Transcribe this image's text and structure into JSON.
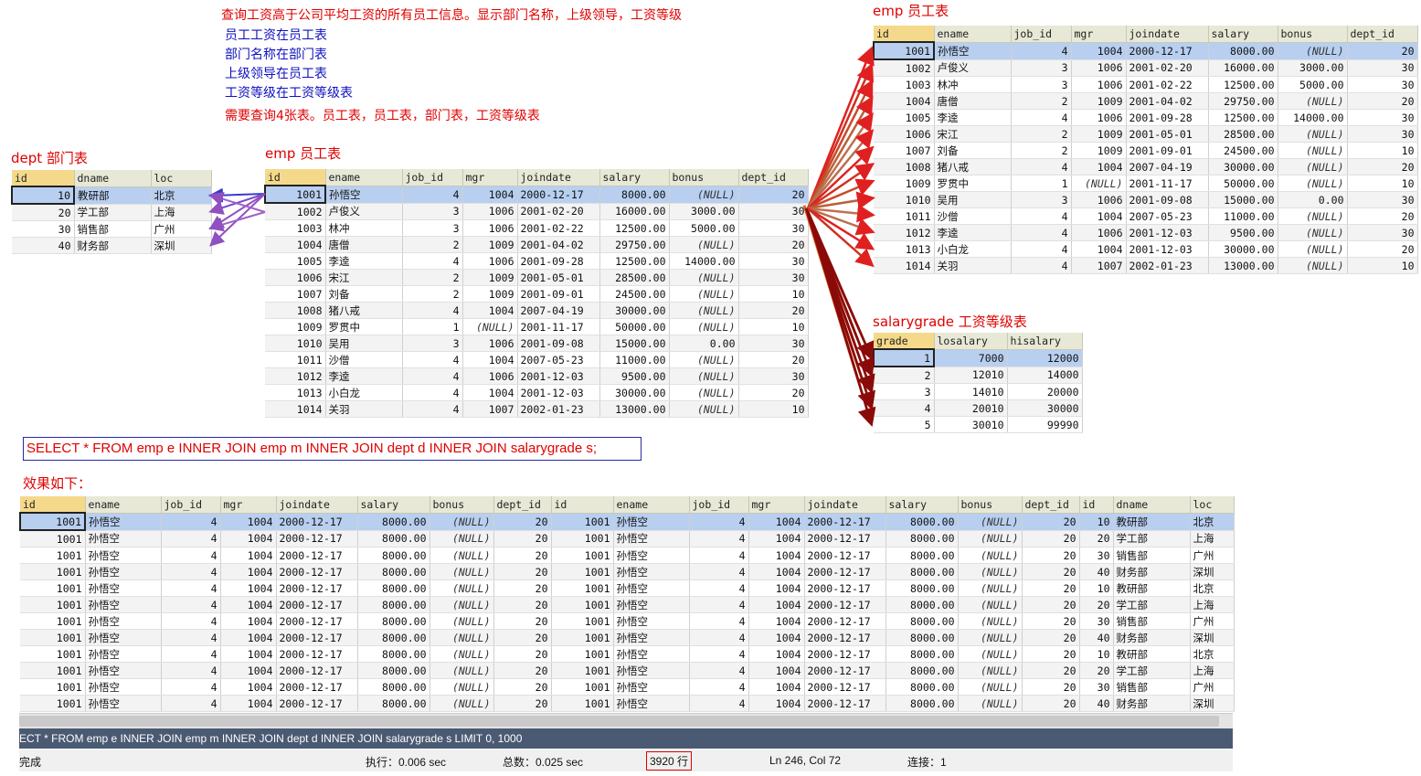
{
  "notes": {
    "title": "查询工资高于公司平均工资的所有员工信息。显示部门名称，上级领导，工资等级",
    "line1": "员工工资在员工表",
    "line2": "部门名称在部门表",
    "line3": "上级领导在员工表",
    "line4": "工资等级在工资等级表",
    "need": "需要查询4张表。员工表，员工表，部门表，工资等级表"
  },
  "labels": {
    "dept": "dept 部门表",
    "emp_left": "emp 员工表",
    "emp_right": "emp 员工表",
    "salarygrade": "salarygrade 工资等级表"
  },
  "dept": {
    "columns": [
      "id",
      "dname",
      "loc"
    ],
    "rows": [
      [
        "10",
        "教研部",
        "北京"
      ],
      [
        "20",
        "学工部",
        "上海"
      ],
      [
        "30",
        "销售部",
        "广州"
      ],
      [
        "40",
        "财务部",
        "深圳"
      ]
    ]
  },
  "emp": {
    "columns": [
      "id",
      "ename",
      "job_id",
      "mgr",
      "joindate",
      "salary",
      "bonus",
      "dept_id"
    ],
    "rows": [
      [
        "1001",
        "孙悟空",
        "4",
        "1004",
        "2000-12-17",
        "8000.00",
        "(NULL)",
        "20"
      ],
      [
        "1002",
        "卢俊义",
        "3",
        "1006",
        "2001-02-20",
        "16000.00",
        "3000.00",
        "30"
      ],
      [
        "1003",
        "林冲",
        "3",
        "1006",
        "2001-02-22",
        "12500.00",
        "5000.00",
        "30"
      ],
      [
        "1004",
        "唐僧",
        "2",
        "1009",
        "2001-04-02",
        "29750.00",
        "(NULL)",
        "20"
      ],
      [
        "1005",
        "李逵",
        "4",
        "1006",
        "2001-09-28",
        "12500.00",
        "14000.00",
        "30"
      ],
      [
        "1006",
        "宋江",
        "2",
        "1009",
        "2001-05-01",
        "28500.00",
        "(NULL)",
        "30"
      ],
      [
        "1007",
        "刘备",
        "2",
        "1009",
        "2001-09-01",
        "24500.00",
        "(NULL)",
        "10"
      ],
      [
        "1008",
        "猪八戒",
        "4",
        "1004",
        "2007-04-19",
        "30000.00",
        "(NULL)",
        "20"
      ],
      [
        "1009",
        "罗贯中",
        "1",
        "(NULL)",
        "2001-11-17",
        "50000.00",
        "(NULL)",
        "10"
      ],
      [
        "1010",
        "吴用",
        "3",
        "1006",
        "2001-09-08",
        "15000.00",
        "0.00",
        "30"
      ],
      [
        "1011",
        "沙僧",
        "4",
        "1004",
        "2007-05-23",
        "11000.00",
        "(NULL)",
        "20"
      ],
      [
        "1012",
        "李逵",
        "4",
        "1006",
        "2001-12-03",
        "9500.00",
        "(NULL)",
        "30"
      ],
      [
        "1013",
        "小白龙",
        "4",
        "1004",
        "2001-12-03",
        "30000.00",
        "(NULL)",
        "20"
      ],
      [
        "1014",
        "关羽",
        "4",
        "1007",
        "2002-01-23",
        "13000.00",
        "(NULL)",
        "10"
      ]
    ]
  },
  "emp2_rows": [
    [
      "1001",
      "孙悟空",
      "4",
      "1004",
      "2000-12-17",
      "8000.00",
      "(NULL)",
      "20"
    ],
    [
      "1002",
      "卢俊义",
      "3",
      "1006",
      "2001-02-20",
      "16000.00",
      "3000.00",
      "30"
    ],
    [
      "1003",
      "林冲",
      "3",
      "1006",
      "2001-02-22",
      "12500.00",
      "5000.00",
      "30"
    ],
    [
      "1004",
      "唐僧",
      "2",
      "1009",
      "2001-04-02",
      "29750.00",
      "(NULL)",
      "20"
    ],
    [
      "1005",
      "李逵",
      "4",
      "1006",
      "2001-09-28",
      "12500.00",
      "14000.00",
      "30"
    ],
    [
      "1006",
      "宋江",
      "2",
      "1009",
      "2001-05-01",
      "28500.00",
      "(NULL)",
      "30"
    ],
    [
      "1007",
      "刘备",
      "2",
      "1009",
      "2001-09-01",
      "24500.00",
      "(NULL)",
      "10"
    ],
    [
      "1008",
      "猪八戒",
      "4",
      "1004",
      "2007-04-19",
      "30000.00",
      "(NULL)",
      "20"
    ],
    [
      "1009",
      "罗贯中",
      "1",
      "(NULL)",
      "2001-11-17",
      "50000.00",
      "(NULL)",
      "10"
    ],
    [
      "1010",
      "吴用",
      "3",
      "1006",
      "2001-09-08",
      "15000.00",
      "0.00",
      "30"
    ],
    [
      "1011",
      "沙僧",
      "4",
      "1004",
      "2007-05-23",
      "11000.00",
      "(NULL)",
      "20"
    ],
    [
      "1012",
      "李逵",
      "4",
      "1006",
      "2001-12-03",
      "9500.00",
      "(NULL)",
      "30"
    ],
    [
      "1013",
      "小白龙",
      "4",
      "1004",
      "2001-12-03",
      "30000.00",
      "(NULL)",
      "20"
    ],
    [
      "1014",
      "关羽",
      "4",
      "1007",
      "2002-01-23",
      "13000.00",
      "(NULL)",
      "10"
    ]
  ],
  "salarygrade": {
    "columns": [
      "grade",
      "losalary",
      "hisalary"
    ],
    "rows": [
      [
        "1",
        "7000",
        "12000"
      ],
      [
        "2",
        "12010",
        "14000"
      ],
      [
        "3",
        "14010",
        "20000"
      ],
      [
        "4",
        "20010",
        "30000"
      ],
      [
        "5",
        "30010",
        "99990"
      ]
    ]
  },
  "sql": "SELECT * FROM emp e INNER JOIN emp m INNER JOIN dept d INNER JOIN salarygrade s;",
  "result_label": "效果如下：",
  "result": {
    "columns": [
      "id",
      "ename",
      "job_id",
      "mgr",
      "joindate",
      "salary",
      "bonus",
      "dept_id",
      "id",
      "ename",
      "job_id",
      "mgr",
      "joindate",
      "salary",
      "bonus",
      "dept_id",
      "id",
      "dname",
      "loc"
    ],
    "rows": [
      [
        "1001",
        "孙悟空",
        "4",
        "1004",
        "2000-12-17",
        "8000.00",
        "(NULL)",
        "20",
        "1001",
        "孙悟空",
        "4",
        "1004",
        "2000-12-17",
        "8000.00",
        "(NULL)",
        "20",
        "10",
        "教研部",
        "北京"
      ],
      [
        "1001",
        "孙悟空",
        "4",
        "1004",
        "2000-12-17",
        "8000.00",
        "(NULL)",
        "20",
        "1001",
        "孙悟空",
        "4",
        "1004",
        "2000-12-17",
        "8000.00",
        "(NULL)",
        "20",
        "20",
        "学工部",
        "上海"
      ],
      [
        "1001",
        "孙悟空",
        "4",
        "1004",
        "2000-12-17",
        "8000.00",
        "(NULL)",
        "20",
        "1001",
        "孙悟空",
        "4",
        "1004",
        "2000-12-17",
        "8000.00",
        "(NULL)",
        "20",
        "30",
        "销售部",
        "广州"
      ],
      [
        "1001",
        "孙悟空",
        "4",
        "1004",
        "2000-12-17",
        "8000.00",
        "(NULL)",
        "20",
        "1001",
        "孙悟空",
        "4",
        "1004",
        "2000-12-17",
        "8000.00",
        "(NULL)",
        "20",
        "40",
        "财务部",
        "深圳"
      ],
      [
        "1001",
        "孙悟空",
        "4",
        "1004",
        "2000-12-17",
        "8000.00",
        "(NULL)",
        "20",
        "1001",
        "孙悟空",
        "4",
        "1004",
        "2000-12-17",
        "8000.00",
        "(NULL)",
        "20",
        "10",
        "教研部",
        "北京"
      ],
      [
        "1001",
        "孙悟空",
        "4",
        "1004",
        "2000-12-17",
        "8000.00",
        "(NULL)",
        "20",
        "1001",
        "孙悟空",
        "4",
        "1004",
        "2000-12-17",
        "8000.00",
        "(NULL)",
        "20",
        "20",
        "学工部",
        "上海"
      ],
      [
        "1001",
        "孙悟空",
        "4",
        "1004",
        "2000-12-17",
        "8000.00",
        "(NULL)",
        "20",
        "1001",
        "孙悟空",
        "4",
        "1004",
        "2000-12-17",
        "8000.00",
        "(NULL)",
        "20",
        "30",
        "销售部",
        "广州"
      ],
      [
        "1001",
        "孙悟空",
        "4",
        "1004",
        "2000-12-17",
        "8000.00",
        "(NULL)",
        "20",
        "1001",
        "孙悟空",
        "4",
        "1004",
        "2000-12-17",
        "8000.00",
        "(NULL)",
        "20",
        "40",
        "财务部",
        "深圳"
      ],
      [
        "1001",
        "孙悟空",
        "4",
        "1004",
        "2000-12-17",
        "8000.00",
        "(NULL)",
        "20",
        "1001",
        "孙悟空",
        "4",
        "1004",
        "2000-12-17",
        "8000.00",
        "(NULL)",
        "20",
        "10",
        "教研部",
        "北京"
      ],
      [
        "1001",
        "孙悟空",
        "4",
        "1004",
        "2000-12-17",
        "8000.00",
        "(NULL)",
        "20",
        "1001",
        "孙悟空",
        "4",
        "1004",
        "2000-12-17",
        "8000.00",
        "(NULL)",
        "20",
        "20",
        "学工部",
        "上海"
      ],
      [
        "1001",
        "孙悟空",
        "4",
        "1004",
        "2000-12-17",
        "8000.00",
        "(NULL)",
        "20",
        "1001",
        "孙悟空",
        "4",
        "1004",
        "2000-12-17",
        "8000.00",
        "(NULL)",
        "20",
        "30",
        "销售部",
        "广州"
      ],
      [
        "1001",
        "孙悟空",
        "4",
        "1004",
        "2000-12-17",
        "8000.00",
        "(NULL)",
        "20",
        "1001",
        "孙悟空",
        "4",
        "1004",
        "2000-12-17",
        "8000.00",
        "(NULL)",
        "20",
        "40",
        "财务部",
        "深圳"
      ]
    ]
  },
  "sql_bar": "ECT * FROM emp e INNER JOIN emp m INNER JOIN dept d INNER JOIN salarygrade s LIMIT 0, 1000",
  "status": {
    "state": "完成",
    "exec": "执行：0.006 sec",
    "total": "总数：0.025 sec",
    "rows": "3920 行",
    "pos": "Ln 246, Col 72",
    "conn": "连接：1"
  },
  "colors": {
    "accent_red": "#e00000",
    "blue_text": "#1010c0",
    "selected_row": "#b8cff0",
    "status_bar": "#4a5a73"
  }
}
